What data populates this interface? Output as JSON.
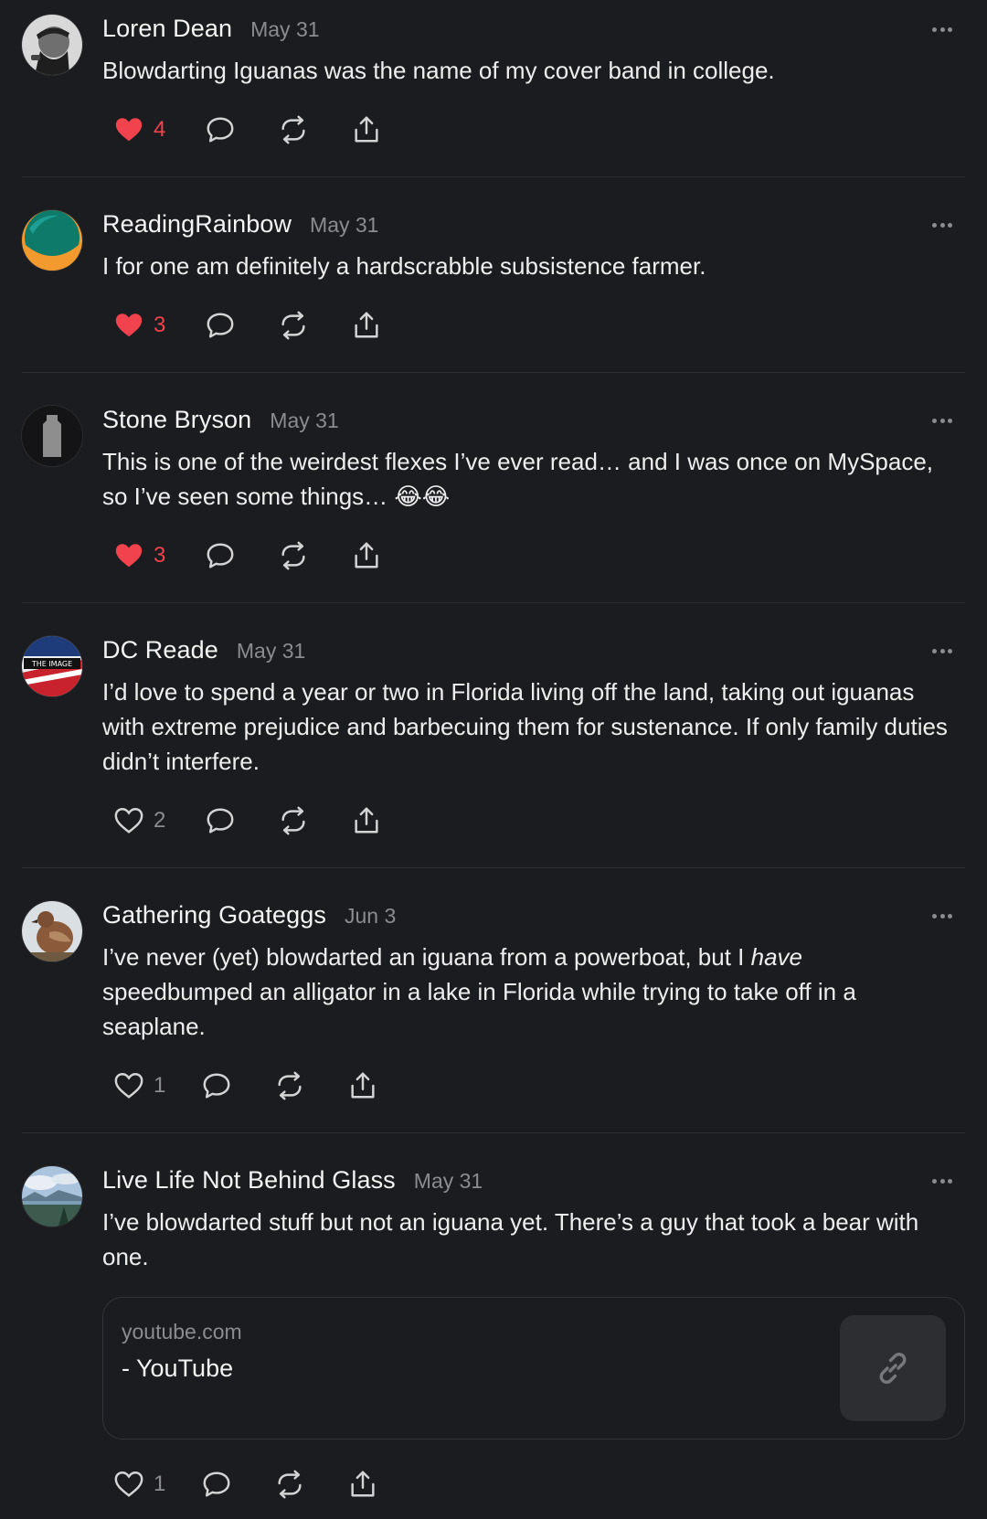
{
  "comments": [
    {
      "author": "Loren Dean",
      "date": "May 31",
      "text": "Blowdarting Iguanas was the name of my cover band in college.",
      "likes": "4",
      "liked": true
    },
    {
      "author": "ReadingRainbow",
      "date": "May 31",
      "text": "I for one am definitely a hardscrabble subsistence farmer.",
      "likes": "3",
      "liked": true
    },
    {
      "author": "Stone Bryson",
      "date": "May 31",
      "text": "This is one of the weirdest flexes I’ve ever read… and I was once on MySpace, so I’ve seen some things… 😂😂",
      "likes": "3",
      "liked": true
    },
    {
      "author": "DC Reade",
      "date": "May 31",
      "text": "I’d love to spend a year or two in Florida living off the land, taking out iguanas with extreme prejudice and barbecuing them for sustenance. If only family duties didn’t interfere.",
      "likes": "2",
      "liked": false,
      "avatar_text": "THE IMAGE"
    },
    {
      "author": "Gathering Goateggs",
      "date": "Jun 3",
      "text_before": "I’ve never (yet) blowdarted an iguana from a powerboat, but I ",
      "text_emphasis": "have",
      "text_after": " speedbumped an alligator in a lake in Florida while trying to take off in a seaplane.",
      "likes": "1",
      "liked": false
    },
    {
      "author": "Live Life Not Behind Glass",
      "date": "May 31",
      "text": "I’ve blowdarted stuff but not an iguana yet. There’s a guy that took a bear with one.",
      "likes": "1",
      "liked": false,
      "link_card": {
        "domain": "youtube.com",
        "title": "- YouTube",
        "icon": "link-icon"
      }
    }
  ],
  "icons": {
    "like": "heart-icon",
    "reply": "speech-bubble-icon",
    "repost": "repost-icon",
    "share": "share-icon",
    "more": "more-options-icon"
  },
  "colors": {
    "background": "#1b1c1f",
    "liked": "#f0434d",
    "muted": "#8b8c90",
    "divider": "#2e2f33"
  }
}
